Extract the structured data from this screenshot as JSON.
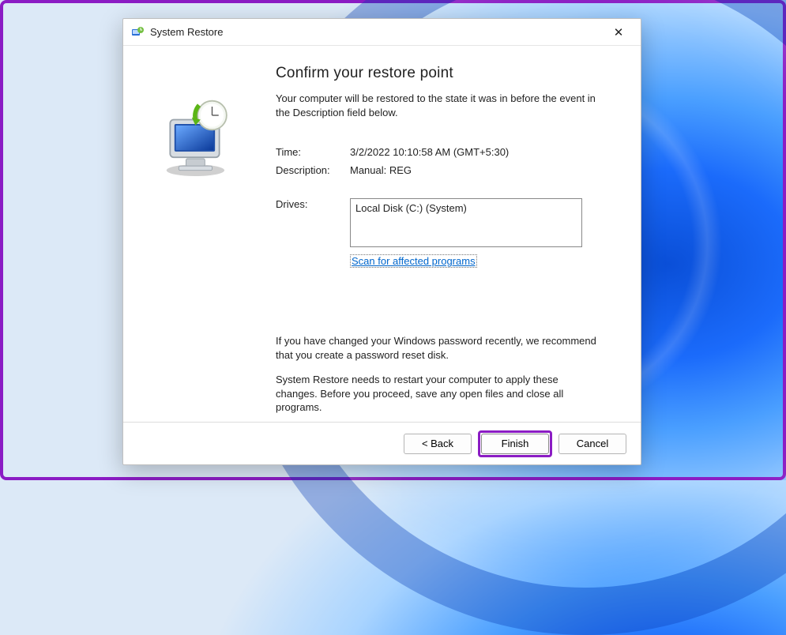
{
  "window": {
    "title": "System Restore",
    "close_glyph": "✕"
  },
  "heading": "Confirm your restore point",
  "intro": "Your computer will be restored to the state it was in before the event in the Description field below.",
  "fields": {
    "time": {
      "label": "Time:",
      "value": "3/2/2022 10:10:58 AM (GMT+5:30)"
    },
    "description": {
      "label": "Description:",
      "value": "Manual: REG"
    },
    "drives": {
      "label": "Drives:"
    }
  },
  "drives_list": "Local Disk (C:) (System)",
  "scan_link": "Scan for affected programs",
  "warning_password": "If you have changed your Windows password recently, we recommend that you create a password reset disk.",
  "warning_restart": "System Restore needs to restart your computer to apply these changes. Before you proceed, save any open files and close all programs.",
  "buttons": {
    "back": "< Back",
    "finish": "Finish",
    "cancel": "Cancel"
  }
}
